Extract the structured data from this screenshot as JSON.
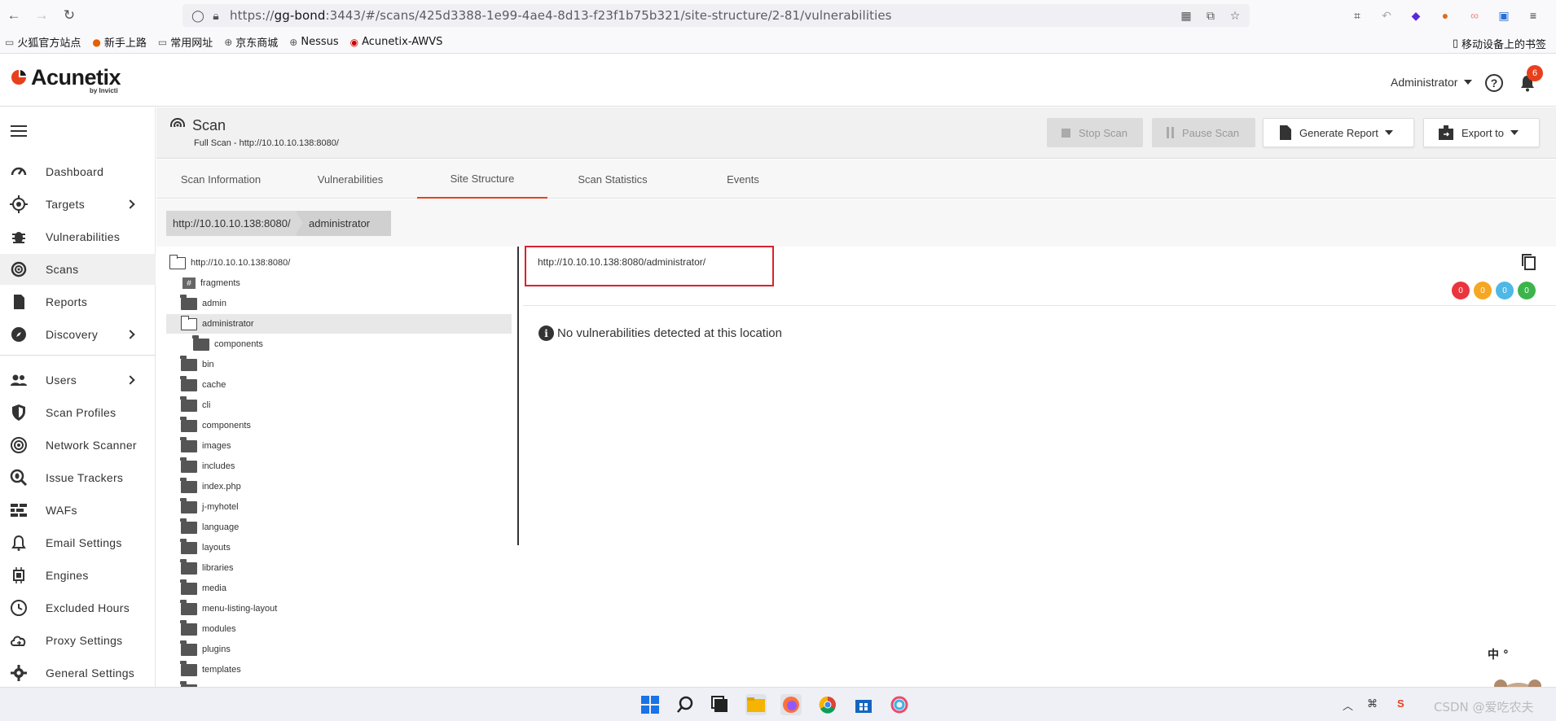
{
  "browser": {
    "url_prefix": "https://",
    "url_host": "gg-bond",
    "url_rest": ":3443/#/scans/425d3388-1e99-4ae4-8d13-f23f1b75b321/site-structure/2-81/vulnerabilities",
    "bookmarks": [
      "火狐官方站点",
      "新手上路",
      "常用网址",
      "京东商城",
      "Nessus",
      "Acunetix-AWVS"
    ],
    "mobile_bookmarks": "移动设备上的书签"
  },
  "header": {
    "logo": "Acunetix",
    "logo_sub": "by Invicti",
    "user": "Administrator",
    "notifications": "6"
  },
  "sidebar": {
    "items": [
      {
        "label": "Dashboard",
        "icon": "gauge-icon"
      },
      {
        "label": "Targets",
        "icon": "target-icon"
      },
      {
        "label": "Vulnerabilities",
        "icon": "bug-icon"
      },
      {
        "label": "Scans",
        "icon": "radar-icon"
      },
      {
        "label": "Reports",
        "icon": "report-icon"
      },
      {
        "label": "Discovery",
        "icon": "compass-icon"
      },
      {
        "label": "Users",
        "icon": "users-icon"
      },
      {
        "label": "Scan Profiles",
        "icon": "shield-icon"
      },
      {
        "label": "Network Scanner",
        "icon": "network-icon"
      },
      {
        "label": "Issue Trackers",
        "icon": "issue-search-icon"
      },
      {
        "label": "WAFs",
        "icon": "firewall-icon"
      },
      {
        "label": "Email Settings",
        "icon": "bell-outline-icon"
      },
      {
        "label": "Engines",
        "icon": "chip-icon"
      },
      {
        "label": "Excluded Hours",
        "icon": "clock-icon"
      },
      {
        "label": "Proxy Settings",
        "icon": "cloud-icon"
      },
      {
        "label": "General Settings",
        "icon": "gear-icon"
      }
    ]
  },
  "scan": {
    "title": "Scan",
    "subtitle": "Full Scan - http://10.10.10.138:8080/",
    "stop": "Stop Scan",
    "pause": "Pause Scan",
    "generate": "Generate Report",
    "export": "Export to"
  },
  "tabs": [
    "Scan Information",
    "Vulnerabilities",
    "Site Structure",
    "Scan Statistics",
    "Events"
  ],
  "breadcrumb": [
    "http://10.10.10.138:8080/",
    "administrator"
  ],
  "tree": {
    "root": "http://10.10.10.138:8080/",
    "items": [
      "fragments",
      "admin",
      "administrator",
      "components",
      "bin",
      "cache",
      "cli",
      "components",
      "images",
      "includes",
      "index.php",
      "j-myhotel",
      "language",
      "layouts",
      "libraries",
      "media",
      "menu-listing-layout",
      "modules",
      "plugins",
      "templates"
    ]
  },
  "detail": {
    "path": "http://10.10.10.138:8080/administrator/",
    "counts": [
      "0",
      "0",
      "0",
      "0"
    ],
    "colors": [
      "#e8353e",
      "#f5a623",
      "#4fb8e6",
      "#3cb44b"
    ],
    "message": "No vulnerabilities detected at this location"
  },
  "tray": {
    "ime": "中 °",
    "watermark": "CSDN @爱吃农夫"
  }
}
